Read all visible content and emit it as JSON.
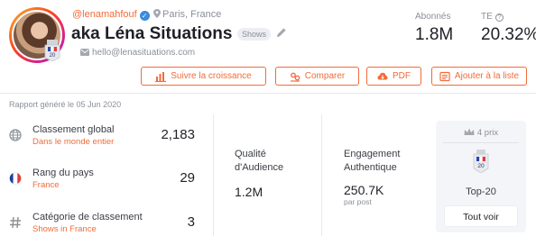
{
  "profile": {
    "handle": "@lenamahfouf",
    "location": "Paris, France",
    "name": "aka Léna Situations",
    "badge": "Shows",
    "email": "hello@lenasituations.com",
    "avatar_badge_number": "20"
  },
  "stats": {
    "followers_label": "Abonnés",
    "followers_value": "1.8M",
    "er_label": "TE",
    "er_value": "20.32%"
  },
  "actions": {
    "growth": "Suivre la croissance",
    "compare": "Comparer",
    "pdf": "PDF",
    "add_to_list": "Ajouter à la liste"
  },
  "report": "Rapport généré le 05 Jun 2020",
  "rankings": [
    {
      "title": "Classement global",
      "subtitle": "Dans le monde entier",
      "value": "2,183"
    },
    {
      "title": "Rang du pays",
      "subtitle": "France",
      "value": "29"
    },
    {
      "title": "Catégorie de classement",
      "subtitle": "Shows in France",
      "value": "3"
    }
  ],
  "audience": {
    "label_line1": "Qualité",
    "label_line2": "d'Audience",
    "value": "1.2M"
  },
  "engagement": {
    "label_line1": "Engagement",
    "label_line2": "Authentique",
    "value": "250.7K",
    "sub": "par post"
  },
  "awards": {
    "count": "4 prix",
    "badge_number": "20",
    "label": "Top-20",
    "button": "Tout voir"
  },
  "colors": {
    "accent": "#f26b3a",
    "verified": "#3a8bdc",
    "muted": "#8a8f98"
  }
}
